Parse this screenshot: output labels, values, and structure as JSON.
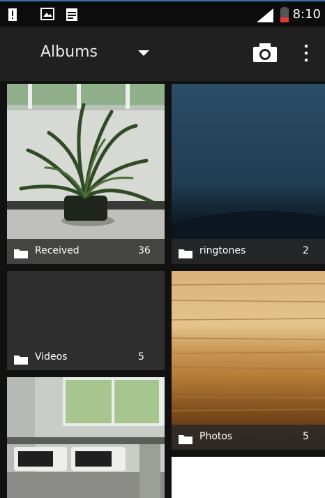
{
  "status_bar": {
    "time": "8:10",
    "icons": [
      "battery-alert-icon",
      "image-notification-icon",
      "log-file-icon",
      "signal-icon",
      "battery-low-icon"
    ]
  },
  "action_bar": {
    "title": "Albums",
    "icons": [
      "dropdown-arrow-icon",
      "camera-icon",
      "overflow-menu-icon"
    ]
  },
  "albums": [
    {
      "name": "Received",
      "count": "36"
    },
    {
      "name": "ringtones",
      "count": "2"
    },
    {
      "name": "Videos",
      "count": "5"
    },
    {
      "name": "Photos",
      "count": "5"
    }
  ],
  "colors": {
    "status_bar": "#0c0c0c",
    "action_bar": "#202020",
    "grid_bg": "#111111",
    "caption_bg": "#282828",
    "accent": "#3a6fb0"
  }
}
